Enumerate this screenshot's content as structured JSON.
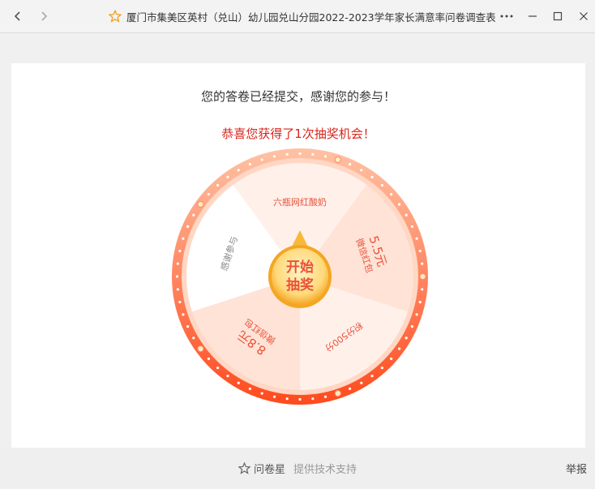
{
  "window": {
    "title": "厦门市集美区英村（兑山）幼儿园兑山分园2022-2023学年家长满意率问卷调查表"
  },
  "survey": {
    "thanks_message": "您的答卷已经提交，感谢您的参与！",
    "prize_message": "恭喜您获得了1次抽奖机会！"
  },
  "wheel": {
    "center_line1": "开始",
    "center_line2": "抽奖",
    "segments": [
      {
        "text": "六瓶网红酸奶"
      },
      {
        "text": "5.5元",
        "sub": "微信红包"
      },
      {
        "text": "积分500分"
      },
      {
        "text": "8.8元",
        "sub": "微信红包"
      },
      {
        "text": "感谢参与"
      }
    ],
    "colors": {
      "ring_outer": "#ff5a2a",
      "ring_inner": "#ffa07a",
      "segment_light": "#fff0ea",
      "segment_white": "#ffffff",
      "segment_text": "#e8523a",
      "button_gold": "#f8b93a"
    }
  },
  "footer": {
    "brand": "问卷星",
    "support": "提供技术支持",
    "report": "举报"
  }
}
